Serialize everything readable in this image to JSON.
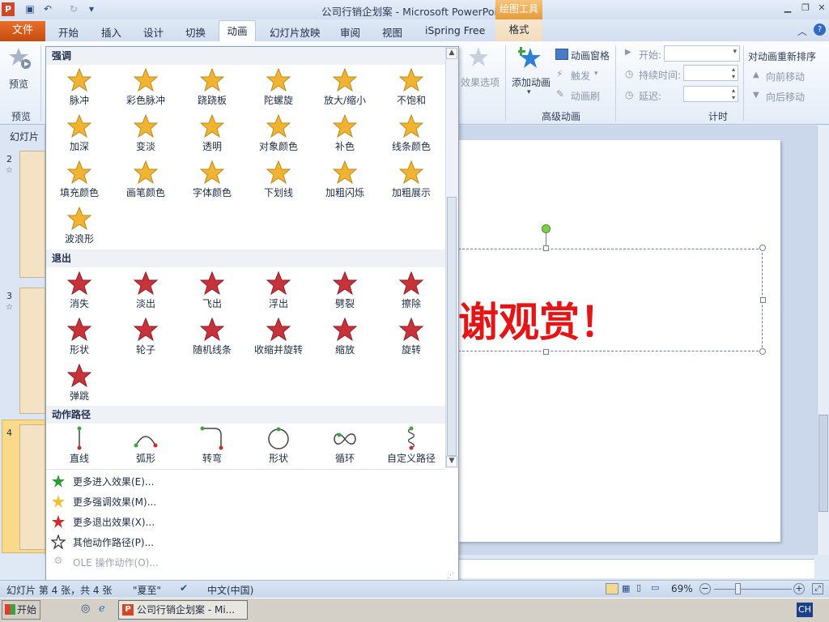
{
  "window": {
    "title": "公司行销企划案 - Microsoft PowerPoint",
    "context_tab_group": "绘图工具"
  },
  "tabs": {
    "file": "文件",
    "items": [
      "开始",
      "插入",
      "设计",
      "切换",
      "动画",
      "幻灯片放映",
      "审阅",
      "视图",
      "iSpring Free"
    ],
    "format": "格式"
  },
  "ribbon": {
    "preview": "预览",
    "preview_group": "预览",
    "effect_options": "效果选项",
    "add_animation": "添加动画",
    "anim_pane": "动画窗格",
    "trigger": "触发",
    "anim_painter": "动画刷",
    "advanced_group": "高级动画",
    "start": "开始:",
    "duration": "持续时间:",
    "delay": "延迟:",
    "timing_group": "计时",
    "reorder": "对动画重新排序",
    "move_earlier": "向前移动",
    "move_later": "向后移动"
  },
  "slides_pane": {
    "tab_label": "幻灯片",
    "numbers": [
      "2",
      "3",
      "4"
    ]
  },
  "slide": {
    "text": "谢观赏！"
  },
  "gallery": {
    "emphasis": {
      "header": "强调",
      "items": [
        "脉冲",
        "彩色脉冲",
        "跷跷板",
        "陀螺旋",
        "放大/缩小",
        "不饱和",
        "加深",
        "变淡",
        "透明",
        "对象颜色",
        "补色",
        "线条颜色",
        "填充颜色",
        "画笔颜色",
        "字体颜色",
        "下划线",
        "加粗闪烁",
        "加粗展示",
        "波浪形"
      ]
    },
    "exit": {
      "header": "退出",
      "items": [
        "消失",
        "淡出",
        "飞出",
        "浮出",
        "劈裂",
        "擦除",
        "形状",
        "轮子",
        "随机线条",
        "收缩并旋转",
        "缩放",
        "旋转",
        "弹跳"
      ]
    },
    "paths": {
      "header": "动作路径",
      "items": [
        "直线",
        "弧形",
        "转弯",
        "形状",
        "循环",
        "自定义路径"
      ]
    },
    "more": [
      "更多进入效果(E)...",
      "更多强调效果(M)...",
      "更多退出效果(X)...",
      "其他动作路径(P)...",
      "OLE 操作动作(O)..."
    ]
  },
  "status": {
    "slide_info": "幻灯片 第 4 张，共 4 张",
    "theme": "\"夏至\"",
    "language": "中文(中国)",
    "zoom": "69%"
  },
  "taskbar": {
    "start": "开始",
    "app": "公司行销企划案 - Mi...",
    "ime": "CH"
  },
  "colors": {
    "accent_orange": "#d6631b",
    "emphasis_star": "#f2b430",
    "exit_star": "#c8323a",
    "slide_text": "#e51515"
  }
}
